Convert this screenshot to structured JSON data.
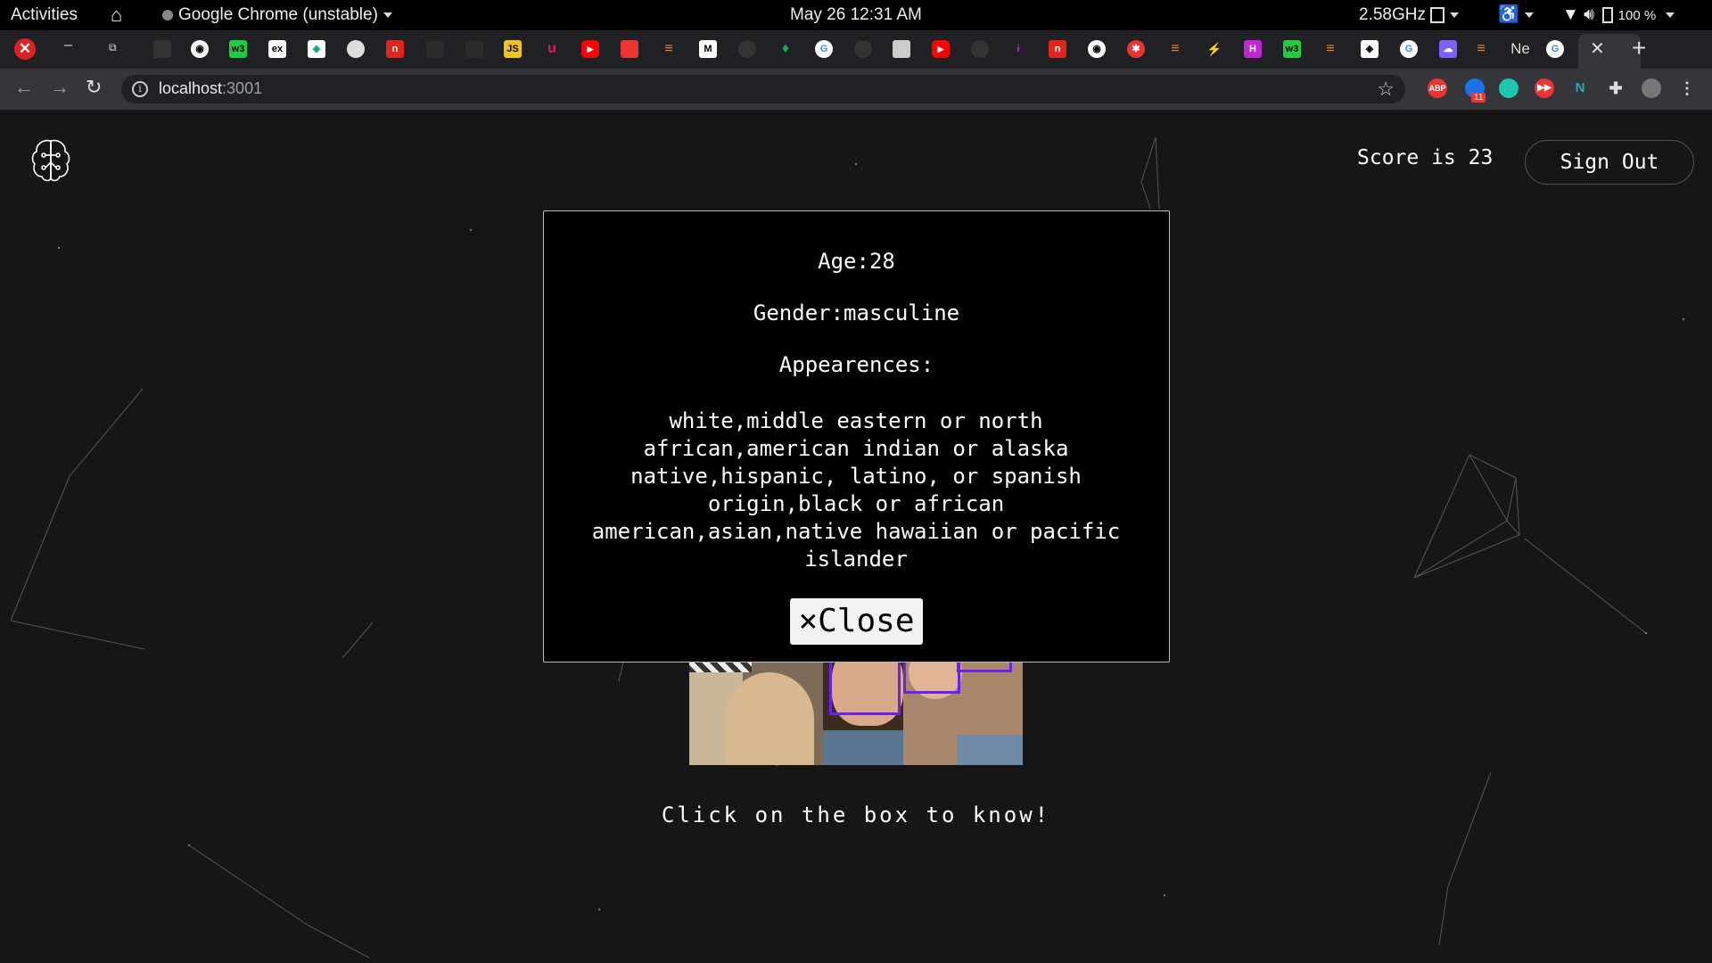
{
  "topbar": {
    "activities": "Activities",
    "app_name": "Google Chrome (unstable)",
    "datetime": "May 26  12:31 AM",
    "cpu": "2.58GHz",
    "battery": "100 %"
  },
  "browser": {
    "url_host": "localhost",
    "url_port": ":3001",
    "partial_tab_title": "Ne",
    "extension_badge": "11"
  },
  "header": {
    "score_text": "Score is 23",
    "signout_label": "Sign Out"
  },
  "modal": {
    "age": "Age:28",
    "gender": "Gender:masculine",
    "appearances_label": "Appearences:",
    "appearances_text": "white,middle eastern or north african,american indian or alaska native,hispanic, latino, or spanish origin,black or african american,asian,native hawaiian or pacific islander",
    "close_label": "×Close"
  },
  "main": {
    "hint": "Click on the box to know!"
  },
  "colors": {
    "page_bg": "#161616",
    "modal_bg": "#000000",
    "face_box": "#6a22ee"
  }
}
